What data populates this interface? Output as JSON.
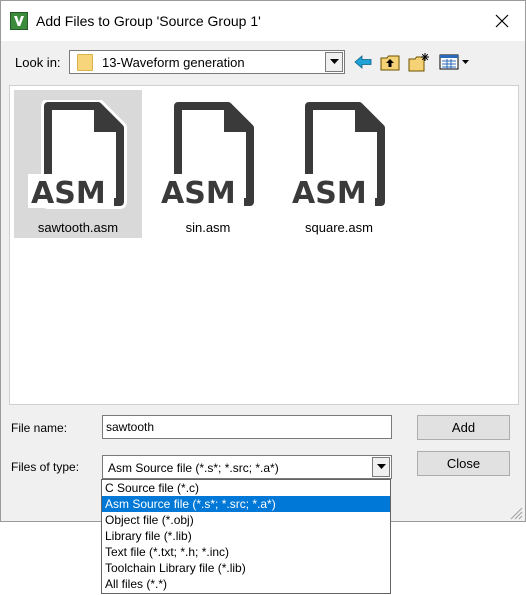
{
  "window": {
    "title": "Add Files to Group 'Source Group 1'",
    "app_icon": "uvision-logo-icon",
    "close_icon": "close-icon"
  },
  "lookin": {
    "label": "Look in:",
    "value": "13-Waveform generation",
    "icons": [
      "folder-icon",
      "chevron-down-icon"
    ]
  },
  "toolbar": {
    "icons": [
      "back-arrow-icon",
      "up-folder-icon",
      "new-folder-icon",
      "view-menu-icon"
    ]
  },
  "files": [
    {
      "name": "sawtooth.asm",
      "icon_label": "ASM",
      "selected": true
    },
    {
      "name": "sin.asm",
      "icon_label": "ASM",
      "selected": false
    },
    {
      "name": "square.asm",
      "icon_label": "ASM",
      "selected": false
    }
  ],
  "form": {
    "filename_label": "File name:",
    "filename_value": "sawtooth",
    "filetype_label": "Files of type:",
    "filetype_value": "Asm Source file (*.s*; *.src; *.a*)"
  },
  "buttons": {
    "add": "Add",
    "close": "Close"
  },
  "filetype_options": [
    {
      "label": "C Source file (*.c)",
      "selected": false
    },
    {
      "label": "Asm Source file (*.s*; *.src; *.a*)",
      "selected": true
    },
    {
      "label": "Object file (*.obj)",
      "selected": false
    },
    {
      "label": "Library file (*.lib)",
      "selected": false
    },
    {
      "label": "Text file (*.txt; *.h; *.inc)",
      "selected": false
    },
    {
      "label": "Toolchain Library file (*.lib)",
      "selected": false
    },
    {
      "label": "All files (*.*)",
      "selected": false
    }
  ],
  "colors": {
    "selection_blue": "#0078d7",
    "selected_item_bg": "#d9d9d9",
    "file_icon_dark": "#3a3a3a",
    "dialog_bg": "#f0f0f0"
  }
}
